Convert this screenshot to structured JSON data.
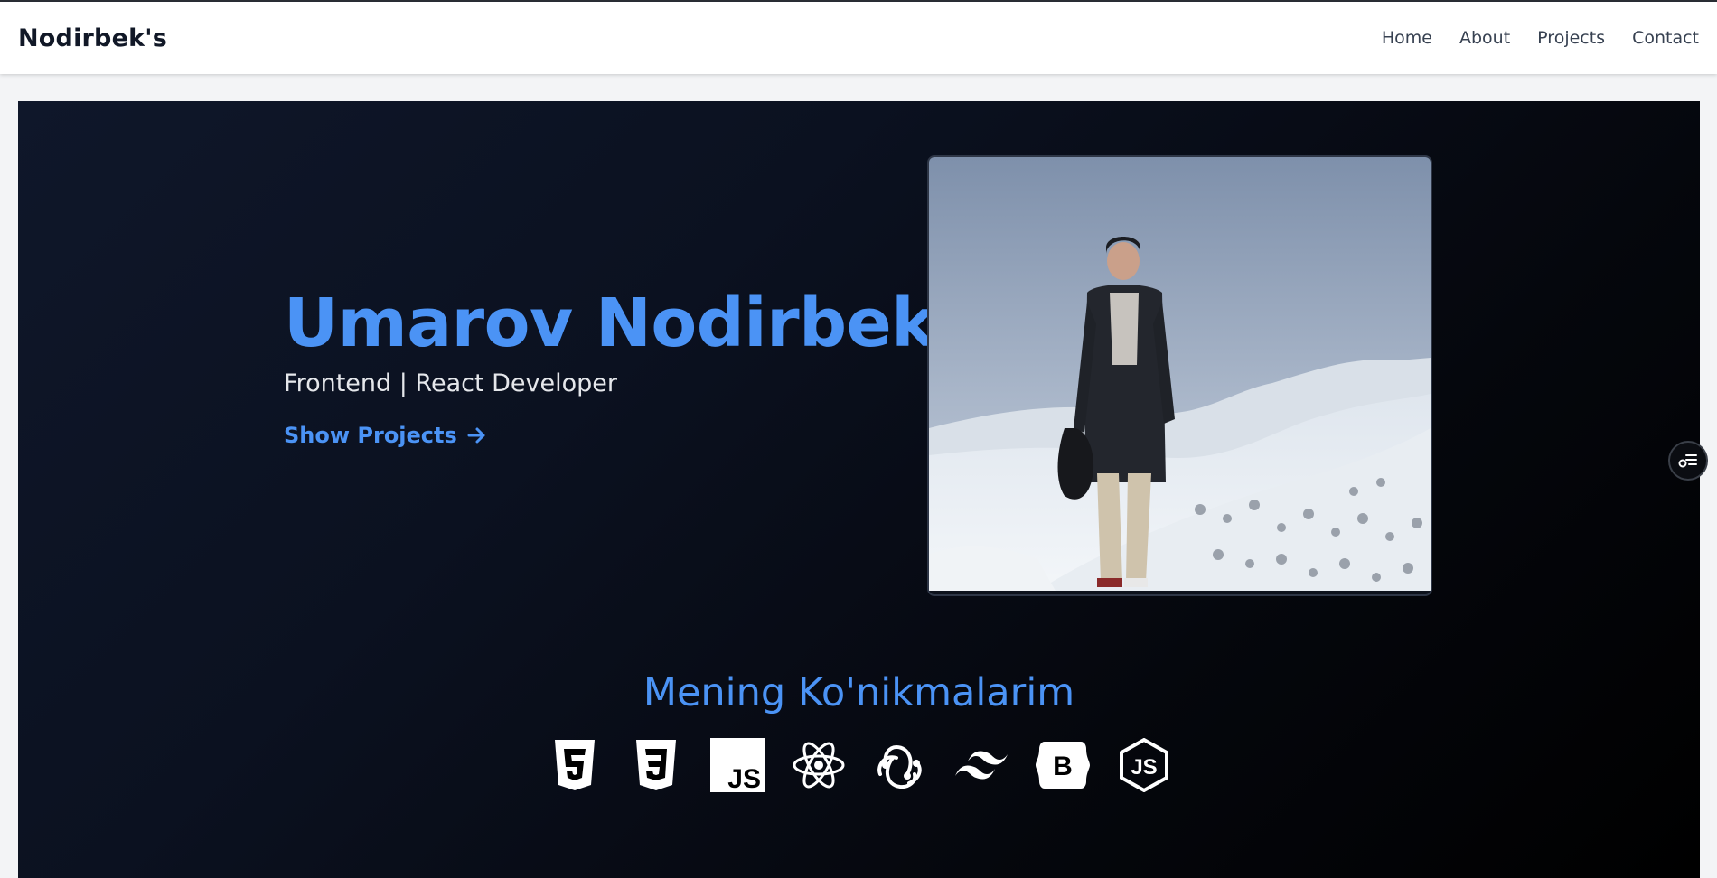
{
  "navbar": {
    "brand": "Nodirbek's",
    "links": [
      "Home",
      "About",
      "Projects",
      "Contact"
    ]
  },
  "hero": {
    "name": "Umarov Nodirbek",
    "role": "Frontend | React Developer",
    "cta_label": "Show Projects",
    "photo_icon": "profile-photo"
  },
  "skills": {
    "title": "Mening Ko'nikmalarim",
    "icons": [
      "html5-icon",
      "css3-icon",
      "javascript-icon",
      "react-icon",
      "redux-icon",
      "tailwind-icon",
      "bootstrap-icon",
      "nodejs-icon"
    ]
  },
  "colors": {
    "accent": "#4b93f5",
    "navbar_bg": "#ffffff",
    "hero_bg_start": "#0f172a",
    "hero_bg_end": "#000000"
  }
}
